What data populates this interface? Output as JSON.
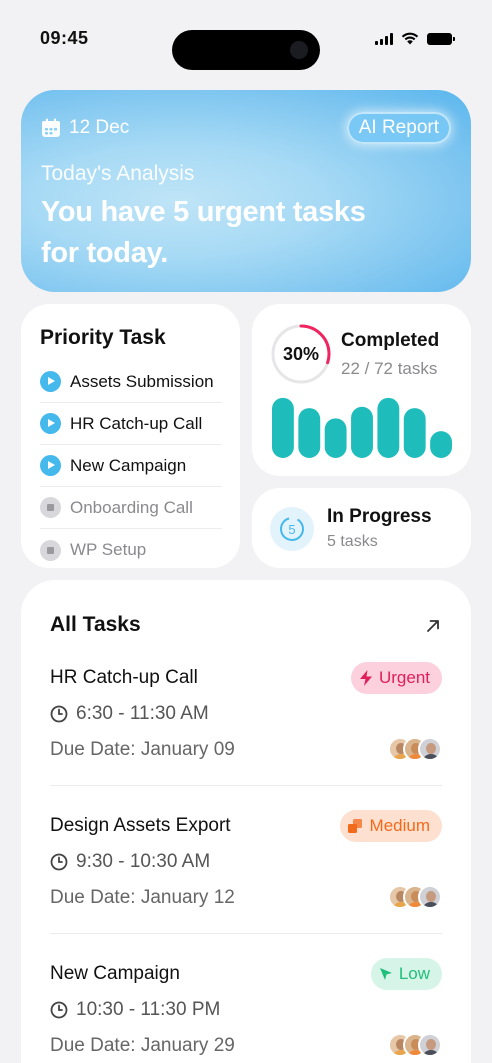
{
  "status_bar": {
    "time": "09:45"
  },
  "hero": {
    "date": "12 Dec",
    "ai_report_label": "AI Report",
    "subtitle": "Today's Analysis",
    "headline": "You have 5 urgent tasks for today."
  },
  "priority": {
    "title": "Priority Task",
    "items": [
      {
        "label": "Assets Submission",
        "state": "play"
      },
      {
        "label": "HR Catch-up Call",
        "state": "play"
      },
      {
        "label": "New Campaign",
        "state": "play"
      },
      {
        "label": "Onboarding Call",
        "state": "stopped"
      },
      {
        "label": "WP Setup",
        "state": "stopped"
      }
    ]
  },
  "completed": {
    "percent_label": "30%",
    "percent": 30,
    "title": "Completed",
    "subtitle": "22 / 72 tasks",
    "bar_levels": [
      0.94,
      0.78,
      0.62,
      0.8,
      0.94,
      0.78,
      0.42
    ],
    "bar_color": "#1fbcbc",
    "ring_color": "#f0245e"
  },
  "in_progress": {
    "icon_number": "5",
    "title": "In Progress",
    "subtitle": "5 tasks"
  },
  "all_tasks": {
    "title": "All Tasks",
    "tasks": [
      {
        "name": "HR Catch-up Call",
        "time": "6:30 - 11:30 AM",
        "due": "Due Date: January 09",
        "priority": "Urgent"
      },
      {
        "name": "Design Assets Export",
        "time": "9:30 - 10:30 AM",
        "due": "Due Date: January 12",
        "priority": "Medium"
      },
      {
        "name": "New Campaign",
        "time": "10:30 - 11:30 PM",
        "due": "Due Date: January 29",
        "priority": "Low"
      }
    ]
  },
  "colors": {
    "urgent": "#e01e5a",
    "medium": "#f26a1b",
    "low": "#1fbf7a",
    "accent_blue": "#45b8ec"
  }
}
